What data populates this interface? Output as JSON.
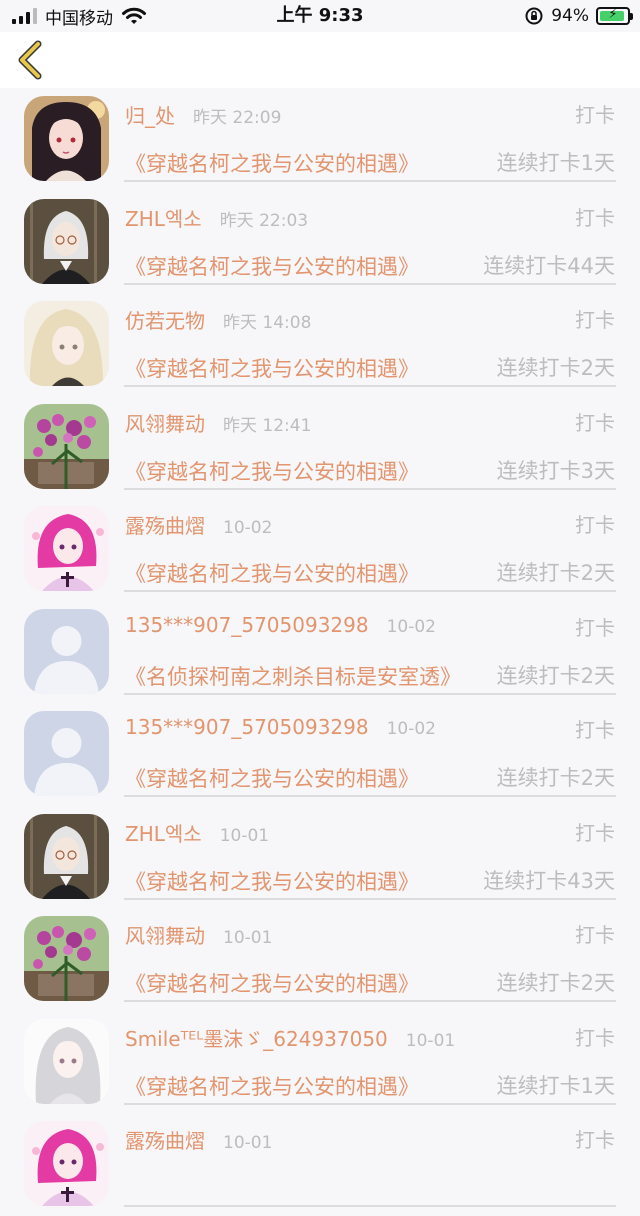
{
  "status_bar": {
    "carrier": "中国移动",
    "time": "上午 9:33",
    "battery_percent": "94%",
    "battery_level": 0.94
  },
  "nav": {
    "back_icon": "chevron-left-icon",
    "accent": "#e8c84a"
  },
  "colors": {
    "name": "#e2956e",
    "muted": "#bdbdbd",
    "divider": "#dcdcdc",
    "background": "#f7f6f8"
  },
  "items": [
    {
      "name": "归_处",
      "time": "昨天 22:09",
      "action": "打卡",
      "book": "《穿越名柯之我与公安的相遇》",
      "streak": "连续打卡1天",
      "avatar": "anime-girl-dark-hair"
    },
    {
      "name": "ZHL엑소",
      "time": "昨天 22:03",
      "action": "打卡",
      "book": "《穿越名柯之我与公安的相遇》",
      "streak": "连续打卡44天",
      "avatar": "anime-boy-white-hair"
    },
    {
      "name": "仿若无物",
      "time": "昨天 14:08",
      "action": "打卡",
      "book": "《穿越名柯之我与公安的相遇》",
      "streak": "连续打卡2天",
      "avatar": "anime-girl-blonde"
    },
    {
      "name": "风翎舞动",
      "time": "昨天 12:41",
      "action": "打卡",
      "book": "《穿越名柯之我与公安的相遇》",
      "streak": "连续打卡3天",
      "avatar": "purple-flowers"
    },
    {
      "name": "露殇曲熠",
      "time": "10-02",
      "action": "打卡",
      "book": "《穿越名柯之我与公安的相遇》",
      "streak": "连续打卡2天",
      "avatar": "anime-pink-hair"
    },
    {
      "name": "135***907_5705093298",
      "time": "10-02",
      "action": "打卡",
      "book": "《名侦探柯南之刺杀目标是安室透》",
      "streak": "连续打卡2天",
      "avatar": "default-person"
    },
    {
      "name": "135***907_5705093298",
      "time": "10-02",
      "action": "打卡",
      "book": "《穿越名柯之我与公安的相遇》",
      "streak": "连续打卡2天",
      "avatar": "default-person"
    },
    {
      "name": "ZHL엑소",
      "time": "10-01",
      "action": "打卡",
      "book": "《穿越名柯之我与公安的相遇》",
      "streak": "连续打卡43天",
      "avatar": "anime-boy-white-hair"
    },
    {
      "name": "风翎舞动",
      "time": "10-01",
      "action": "打卡",
      "book": "《穿越名柯之我与公安的相遇》",
      "streak": "连续打卡2天",
      "avatar": "purple-flowers"
    },
    {
      "name": "Smileᵀᴱᴸ墨沫ゞ_624937050",
      "time": "10-01",
      "action": "打卡",
      "book": "《穿越名柯之我与公安的相遇》",
      "streak": "连续打卡1天",
      "avatar": "anime-girl-silver-hair"
    },
    {
      "name": "露殇曲熠",
      "time": "10-01",
      "action": "打卡",
      "book": "",
      "streak": "",
      "avatar": "anime-pink-hair"
    }
  ]
}
